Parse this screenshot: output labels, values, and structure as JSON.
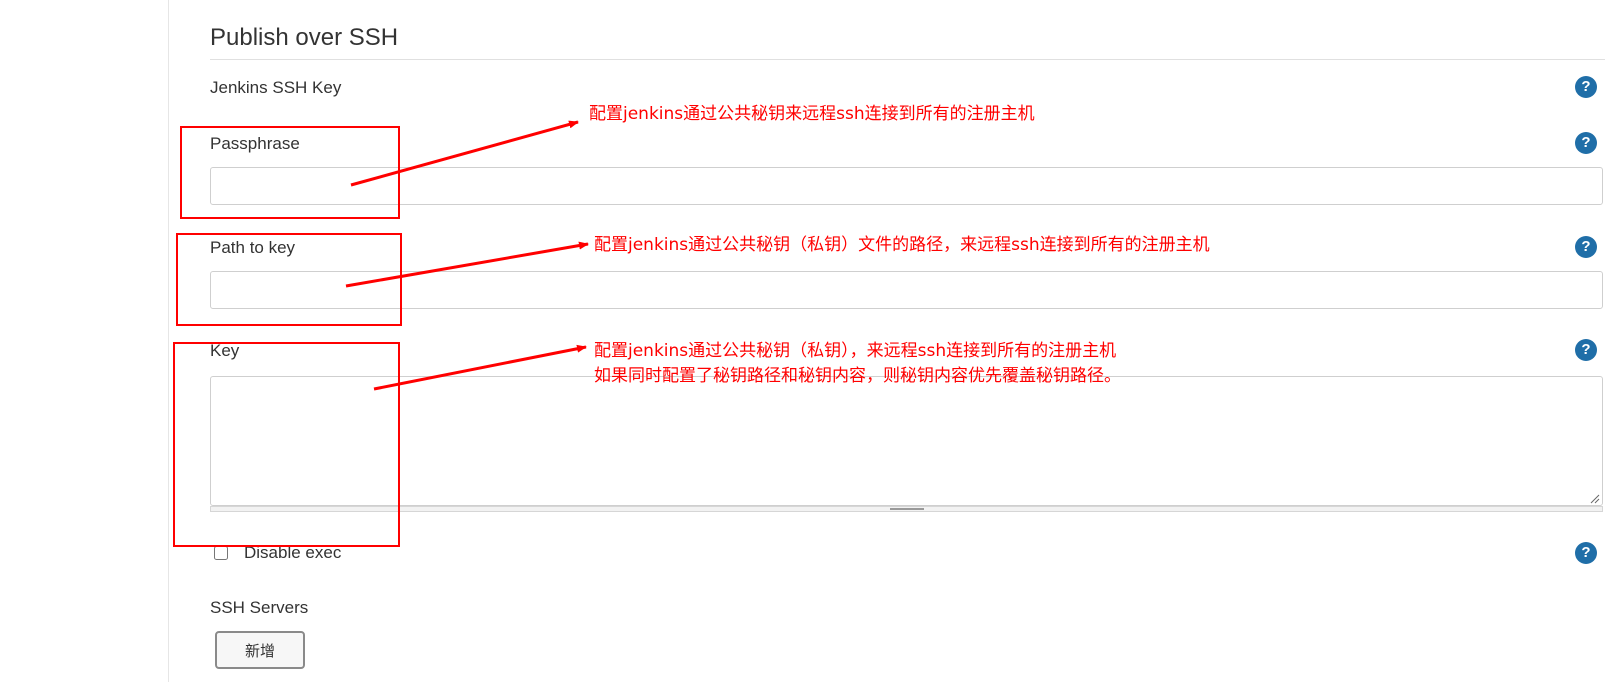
{
  "section": {
    "title": "Publish over SSH"
  },
  "fields": {
    "jenkins_ssh_key_label": "Jenkins SSH Key",
    "passphrase_label": "Passphrase",
    "passphrase_value": "",
    "path_to_key_label": "Path to key",
    "path_to_key_value": "",
    "key_label": "Key",
    "key_value": "",
    "disable_exec_label": "Disable exec",
    "disable_exec_checked": false,
    "ssh_servers_label": "SSH Servers",
    "add_button_label": "新增",
    "help_icon_glyph": "?"
  },
  "annotations": {
    "color": "#ff0000",
    "note1": "配置jenkins通过公共秘钥来远程ssh连接到所有的注册主机",
    "note2": "配置jenkins通过公共秘钥（私钥）文件的路径，来远程ssh连接到所有的注册主机",
    "note3_line1": "配置jenkins通过公共秘钥（私钥），来远程ssh连接到所有的注册主机",
    "note3_line2": "如果同时配置了秘钥路径和秘钥内容，则秘钥内容优先覆盖秘钥路径。"
  },
  "colors": {
    "help_icon": "#1f6ea8",
    "annotation": "#ff0000"
  }
}
